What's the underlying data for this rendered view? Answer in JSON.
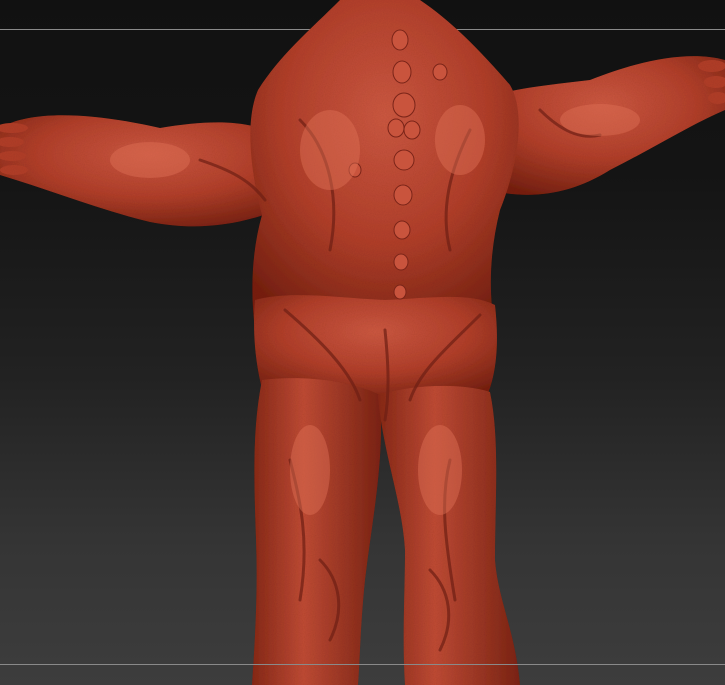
{
  "canvas": {
    "background_top": "#111111",
    "background_bottom": "#3d3d3d",
    "guide_line_color": "#8a8a8a"
  },
  "model": {
    "subject": "sculpted-creature-back-view",
    "material_color": "#b4412c",
    "highlight_color": "#d9614a",
    "shadow_color": "#6e1f14"
  }
}
